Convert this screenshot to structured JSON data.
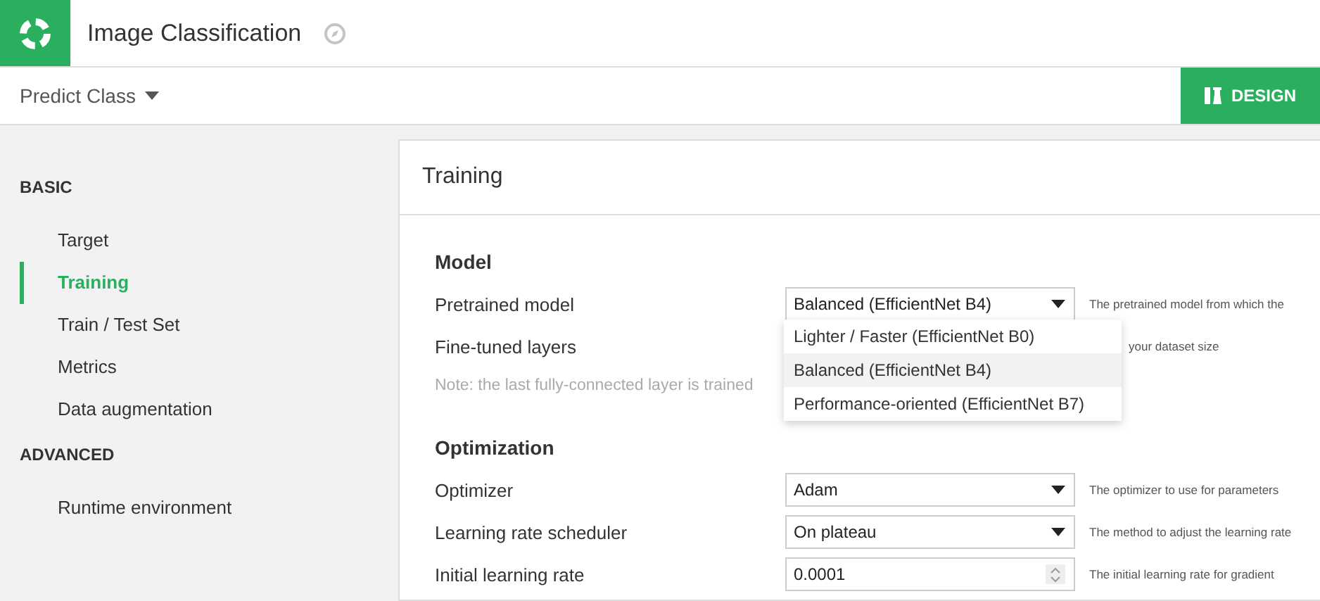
{
  "header": {
    "title": "Image Classification"
  },
  "subheader": {
    "menu_label": "Predict Class",
    "design_button": "DESIGN"
  },
  "sidebar": {
    "sections": [
      {
        "heading": "BASIC",
        "items": [
          {
            "label": "Target",
            "selected": false
          },
          {
            "label": "Training",
            "selected": true
          },
          {
            "label": "Train / Test Set",
            "selected": false
          },
          {
            "label": "Metrics",
            "selected": false
          },
          {
            "label": "Data augmentation",
            "selected": false
          }
        ]
      },
      {
        "heading": "ADVANCED",
        "items": [
          {
            "label": "Runtime environment",
            "selected": false
          }
        ]
      }
    ]
  },
  "panel": {
    "title": "Training",
    "groups": [
      {
        "heading": "Model",
        "rows": [
          {
            "kind": "select",
            "label": "Pretrained model",
            "value": "Balanced (EfficientNet B4)",
            "help": "The pretrained model from which the"
          },
          {
            "kind": "text",
            "label": "Fine-tuned layers",
            "help": "your dataset size"
          },
          {
            "kind": "note",
            "label": "Note: the last fully-connected layer is trained"
          }
        ]
      },
      {
        "heading": "Optimization",
        "rows": [
          {
            "kind": "select",
            "label": "Optimizer",
            "value": "Adam",
            "help": "The optimizer to use for parameters"
          },
          {
            "kind": "select",
            "label": "Learning rate scheduler",
            "value": "On plateau",
            "help": "The method to adjust the learning rate"
          },
          {
            "kind": "number",
            "label": "Initial learning rate",
            "value": "0.0001",
            "help": "The initial learning rate for gradient"
          }
        ]
      }
    ]
  },
  "dropdown": {
    "options": [
      {
        "label": "Lighter / Faster (EfficientNet B0)",
        "selected": false
      },
      {
        "label": "Balanced (EfficientNet B4)",
        "selected": true
      },
      {
        "label": "Performance-oriented (EfficientNet B7)",
        "selected": false
      }
    ]
  }
}
